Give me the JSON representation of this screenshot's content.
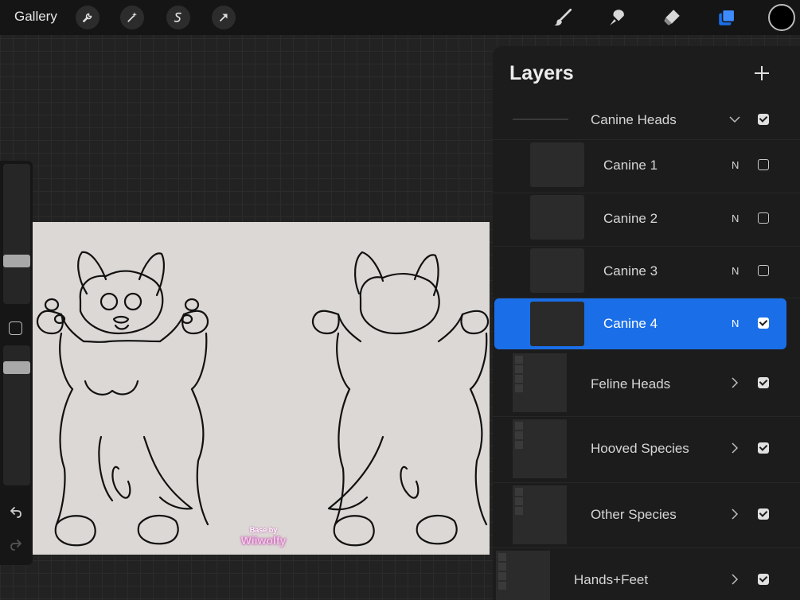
{
  "toolbar": {
    "gallery_label": "Gallery",
    "left_tools": [
      "wrench-icon",
      "magic-wand-icon",
      "selection-icon",
      "transform-arrow-icon"
    ],
    "right_tools": [
      "brush-icon",
      "smudge-icon",
      "eraser-icon",
      "layers-icon"
    ],
    "current_color": "#000000",
    "accent_color": "#1a6fe8"
  },
  "artwork": {
    "watermark_line1": "Base by",
    "watermark_line2": "Wiiwolfy"
  },
  "layers_panel": {
    "title": "Layers",
    "rows": [
      {
        "name": "Canine Heads",
        "type": "group",
        "expanded": true,
        "visible": true
      },
      {
        "name": "Canine 1",
        "type": "layer",
        "mode": "N",
        "visible": false
      },
      {
        "name": "Canine 2",
        "type": "layer",
        "mode": "N",
        "visible": false
      },
      {
        "name": "Canine 3",
        "type": "layer",
        "mode": "N",
        "visible": false
      },
      {
        "name": "Canine 4",
        "type": "layer",
        "mode": "N",
        "visible": true,
        "selected": true
      },
      {
        "name": "Feline Heads",
        "type": "group",
        "expanded": false,
        "visible": true
      },
      {
        "name": "Hooved Species",
        "type": "group",
        "expanded": false,
        "visible": true
      },
      {
        "name": "Other Species",
        "type": "group",
        "expanded": false,
        "visible": true
      },
      {
        "name": "Hands+Feet",
        "type": "group",
        "expanded": false,
        "visible": true
      }
    ]
  }
}
